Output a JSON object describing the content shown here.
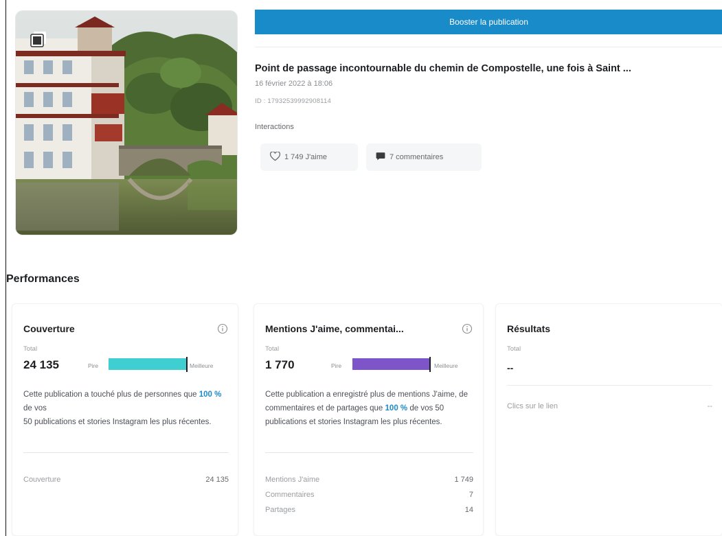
{
  "colors": {
    "primary": "#1a8bc9",
    "coverage_bar": "#3fcfd0",
    "interactions_bar": "#7e55c9",
    "highlight": "#1a8bc9"
  },
  "post": {
    "boost_label": "Booster la publication",
    "title": "Point de passage incontournable du chemin de Compostelle, une fois à Saint ...",
    "date": "16 février 2022 à 18:06",
    "id_text": "ID : 17932539992908114",
    "interactions_label": "Interactions",
    "likes_text": "1 749 J'aime",
    "comments_text": "7 commentaires",
    "thumbnail_icon": "carousel-icon"
  },
  "performance": {
    "title": "Performances",
    "coverage": {
      "title": "Couverture",
      "sub": "Total",
      "value": "24 135",
      "bar_low": "Pire",
      "bar_high": "Meilleure",
      "bar_fraction": 1.0,
      "desc_1": "Cette publication a touché plus de personnes que ",
      "desc_pct": "100 %",
      "desc_2": " de vos ",
      "desc_3": "50 publications et stories Instagram les plus récentes.",
      "rows": [
        {
          "label": "Couverture",
          "value": "24 135"
        }
      ]
    },
    "interactions": {
      "title": "Mentions J'aime, commentai...",
      "sub": "Total",
      "value": "1 770",
      "bar_low": "Pire",
      "bar_high": "Meilleure",
      "bar_fraction": 1.0,
      "desc_1": "Cette publication a enregistré plus de mentions J'aime, de commentaires et de partages que ",
      "desc_pct": "100 %",
      "desc_2": " de vos 50 publications et stories Instagram les plus récentes.",
      "rows": [
        {
          "label": "Mentions J'aime",
          "value": "1 749"
        },
        {
          "label": "Commentaires",
          "value": "7"
        },
        {
          "label": "Partages",
          "value": "14"
        }
      ]
    },
    "results": {
      "title": "Résultats",
      "sub": "Total",
      "value": "--",
      "link_label": "Clics sur le lien",
      "link_value": "--"
    }
  }
}
